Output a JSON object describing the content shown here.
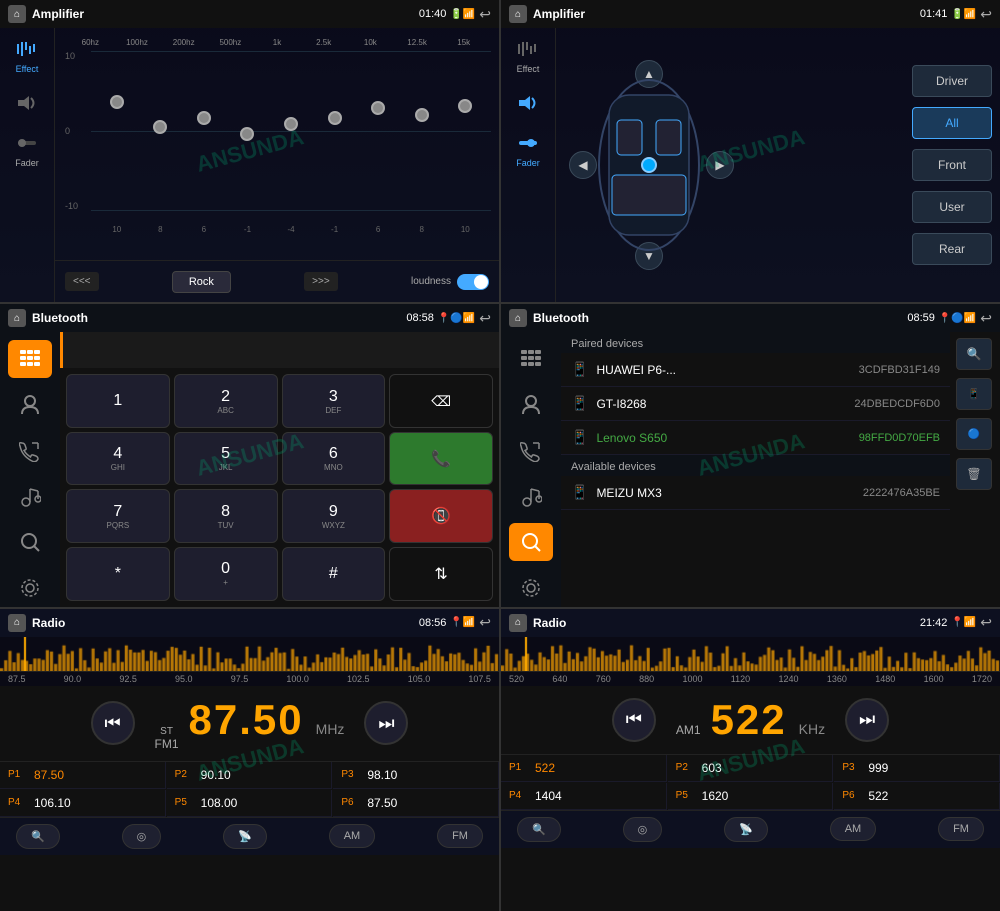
{
  "panels": {
    "amp_eq": {
      "title": "Amplifier",
      "time": "01:40",
      "sidebar": {
        "effect_label": "Effect",
        "fader_label": "Fader"
      },
      "freq_labels": [
        "60hz",
        "100hz",
        "200hz",
        "500hz",
        "1k",
        "2.5k",
        "10k",
        "12.5k",
        "15k"
      ],
      "db_labels": [
        "10",
        "",
        "0",
        "",
        "-10"
      ],
      "slider_values": [
        65,
        50,
        55,
        45,
        48,
        52,
        58,
        55,
        60
      ],
      "preset": "Rock",
      "loudness": "loudness",
      "nav_left": "<<<",
      "nav_right": ">>>"
    },
    "amp_fader": {
      "title": "Amplifier",
      "time": "01:41",
      "sidebar": {
        "effect_label": "Effect",
        "fader_label": "Fader"
      },
      "buttons": {
        "driver": "Driver",
        "all": "All",
        "front": "Front",
        "user": "User",
        "rear": "Rear"
      }
    },
    "bt_dialer": {
      "title": "Bluetooth",
      "time": "08:58",
      "keys": [
        {
          "main": "1",
          "sub": ""
        },
        {
          "main": "2",
          "sub": "ABC"
        },
        {
          "main": "3",
          "sub": "DEF"
        },
        {
          "main": "⌫",
          "sub": "",
          "type": "dark"
        },
        {
          "main": "4",
          "sub": "GHI"
        },
        {
          "main": "5",
          "sub": "JKL"
        },
        {
          "main": "6",
          "sub": "MNO"
        },
        {
          "main": "📞",
          "sub": "",
          "type": "green"
        },
        {
          "main": "7",
          "sub": "PQRS"
        },
        {
          "main": "8",
          "sub": "TUV"
        },
        {
          "main": "9",
          "sub": "WXYZ"
        },
        {
          "main": "📵",
          "sub": "",
          "type": "red"
        },
        {
          "main": "*",
          "sub": ""
        },
        {
          "main": "0",
          "sub": "+"
        },
        {
          "main": "#",
          "sub": ""
        },
        {
          "main": "⇅",
          "sub": "",
          "type": "dark"
        }
      ]
    },
    "bt_devices": {
      "title": "Bluetooth",
      "time": "08:59",
      "paired_label": "Paired devices",
      "available_label": "Available devices",
      "paired": [
        {
          "name": "HUAWEI P6-...",
          "addr": "3CDFBD31F149",
          "connected": false
        },
        {
          "name": "GT-I8268",
          "addr": "24DBEDCDF6D0",
          "connected": false
        },
        {
          "name": "Lenovo S650",
          "addr": "98FFD0D70EFB",
          "connected": true
        }
      ],
      "available": [
        {
          "name": "MEIZU MX3",
          "addr": "2222476A35BE"
        }
      ]
    },
    "radio_fm": {
      "title": "Radio",
      "time": "08:56",
      "band": "FM1",
      "badge": "ST",
      "frequency": "87.50",
      "unit": "MHz",
      "freq_scale": [
        "87.5",
        "90.0",
        "92.5",
        "95.0",
        "97.5",
        "100.0",
        "102.5",
        "105.0",
        "107.5"
      ],
      "presets": [
        {
          "label": "P1",
          "value": "87.50",
          "active": true
        },
        {
          "label": "P2",
          "value": "90.10",
          "active": false
        },
        {
          "label": "P3",
          "value": "98.10",
          "active": false
        },
        {
          "label": "P4",
          "value": "106.10",
          "active": false
        },
        {
          "label": "P5",
          "value": "108.00",
          "active": false
        },
        {
          "label": "P6",
          "value": "87.50",
          "active": false
        }
      ],
      "bottom_btns": [
        "AM",
        "FM"
      ]
    },
    "radio_am": {
      "title": "Radio",
      "time": "21:42",
      "band": "AM1",
      "frequency": "522",
      "unit": "KHz",
      "freq_scale": [
        "520",
        "640",
        "760",
        "880",
        "1000",
        "1120",
        "1240",
        "1360",
        "1480",
        "1600",
        "1720"
      ],
      "presets": [
        {
          "label": "P1",
          "value": "522",
          "active": true
        },
        {
          "label": "P2",
          "value": "603",
          "active": false
        },
        {
          "label": "P3",
          "value": "999",
          "active": false
        },
        {
          "label": "P4",
          "value": "1404",
          "active": false
        },
        {
          "label": "P5",
          "value": "1620",
          "active": false
        },
        {
          "label": "P6",
          "value": "522",
          "active": false
        }
      ],
      "bottom_btns": [
        "AM",
        "FM"
      ]
    }
  },
  "watermark": "ANSUNDA"
}
